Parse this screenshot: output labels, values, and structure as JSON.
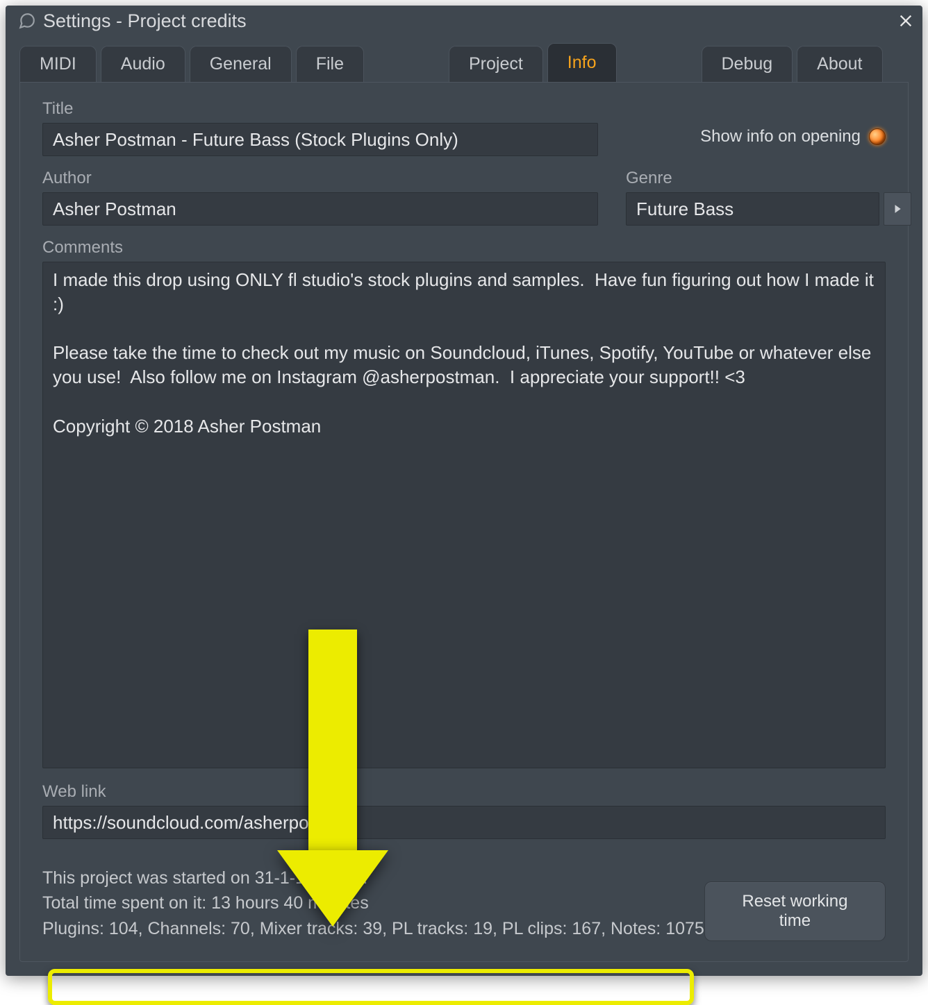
{
  "window": {
    "title": "Settings - Project credits"
  },
  "tabs": {
    "group1": [
      "MIDI",
      "Audio",
      "General",
      "File"
    ],
    "group2": [
      "Project",
      "Info"
    ],
    "group3": [
      "Debug",
      "About"
    ],
    "active": "Info"
  },
  "fields": {
    "title_label": "Title",
    "title_value": "Asher Postman - Future Bass (Stock Plugins Only)",
    "author_label": "Author",
    "author_value": "Asher Postman",
    "genre_label": "Genre",
    "genre_value": "Future Bass",
    "comments_label": "Comments",
    "comments_value": "I made this drop using ONLY fl studio's stock plugins and samples.  Have fun figuring out how I made it :)\n\nPlease take the time to check out my music on Soundcloud, iTunes, Spotify, YouTube or whatever else you use!  Also follow me on Instagram @asherpostman.  I appreciate your support!! <3\n\nCopyright © 2018 Asher Postman",
    "weblink_label": "Web link",
    "weblink_value": "https://soundcloud.com/asherpostman",
    "show_info_label": "Show info on opening"
  },
  "footer": {
    "started_line": "This project was started on 31-1-18 21:15.",
    "timespent_line": "Total time spent on it: 13 hours 40 minutes",
    "stats_line": "Plugins: 104, Channels: 70, Mixer tracks: 39, PL tracks: 19, PL clips: 167, Notes: 1075",
    "reset_label": "Reset working time"
  }
}
